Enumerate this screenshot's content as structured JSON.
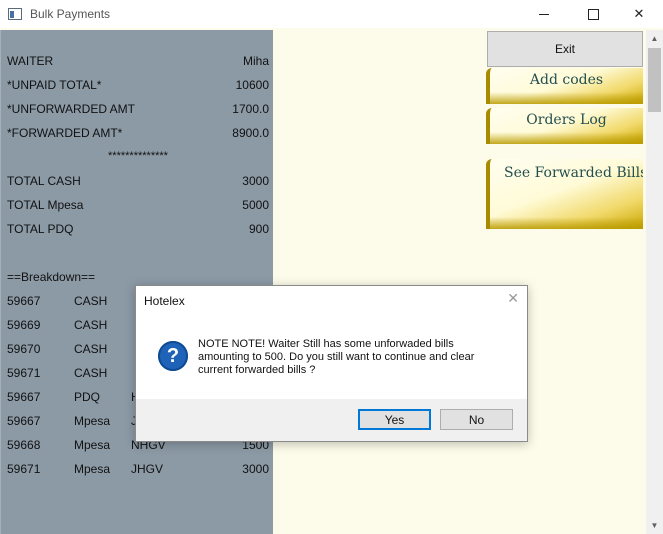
{
  "window": {
    "title": "Bulk Payments",
    "minimize": "–",
    "maximize": "☐",
    "close": "✕"
  },
  "summary": {
    "waiter_label": "WAITER",
    "waiter_value": "Miha",
    "unpaid_label": "*UNPAID TOTAL*",
    "unpaid_value": "10600",
    "unforwarded_label": "*UNFORWARDED AMT",
    "unforwarded_value": "1700.0",
    "forwarded_label": "*FORWARDED AMT*",
    "forwarded_value": "8900.0",
    "separator": "**************",
    "cash_label": "TOTAL CASH",
    "cash_value": "3000",
    "mpesa_label": "TOTAL Mpesa",
    "mpesa_value": "5000",
    "pdq_label": "TOTAL PDQ",
    "pdq_value": "900",
    "breakdown_header": "==Breakdown=="
  },
  "breakdown": [
    {
      "id": "59667",
      "method": "CASH",
      "code": "",
      "amount": ""
    },
    {
      "id": "59669",
      "method": "CASH",
      "code": "",
      "amount": ""
    },
    {
      "id": "59670",
      "method": "CASH",
      "code": "",
      "amount": ""
    },
    {
      "id": "59671",
      "method": "CASH",
      "code": "",
      "amount": ""
    },
    {
      "id": "59667",
      "method": "PDQ",
      "code": "H",
      "amount": ""
    },
    {
      "id": "59667",
      "method": "Mpesa",
      "code": "J",
      "amount": ""
    },
    {
      "id": "59668",
      "method": "Mpesa",
      "code": "NHGV",
      "amount": "1500"
    },
    {
      "id": "59671",
      "method": "Mpesa",
      "code": "JHGV",
      "amount": "3000"
    }
  ],
  "actions": {
    "exit": "Exit",
    "add_codes": "Add codes",
    "orders_log": "Orders Log",
    "see_forwarded": "See Forwarded Bills"
  },
  "dialog": {
    "title": "Hotelex",
    "close": "✕",
    "icon": "question-icon",
    "icon_glyph": "?",
    "message_line1": "NOTE NOTE! Waiter Still has some unforwaded bills",
    "message_line2": "amounting to 500. Do you still want to continue and clear",
    "message_line3": "current forwarded bills ?",
    "yes": "Yes",
    "no": "No"
  },
  "colors": {
    "left_panel": "#8c9aa6",
    "background": "#fdfcea",
    "gold_button_text": "#244f4f",
    "dialog_default_border": "#0078d7"
  }
}
